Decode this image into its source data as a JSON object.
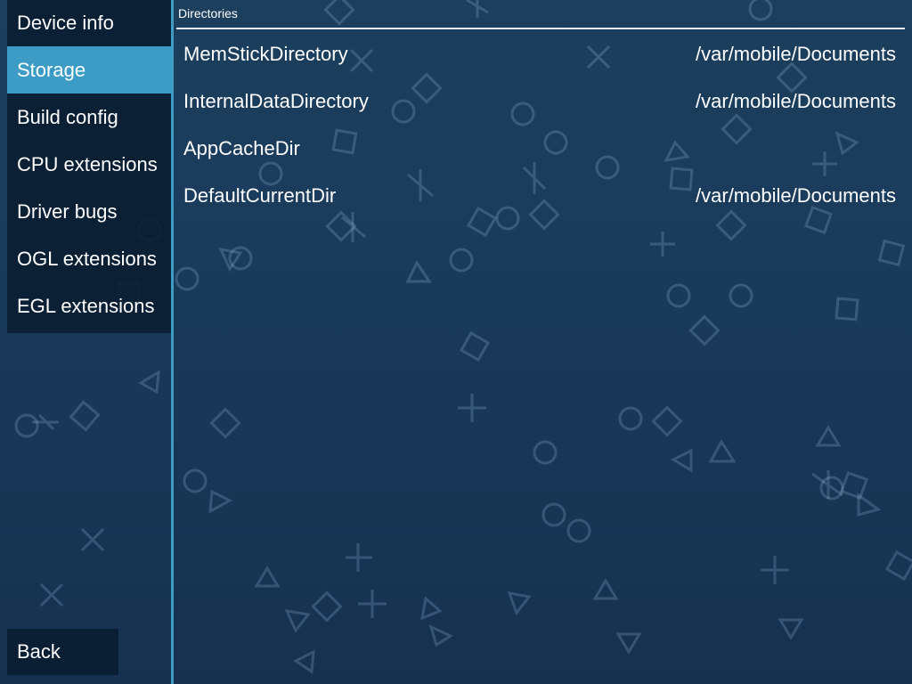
{
  "sidebar": {
    "items": [
      {
        "label": "Device info"
      },
      {
        "label": "Storage"
      },
      {
        "label": "Build config"
      },
      {
        "label": "CPU extensions"
      },
      {
        "label": "Driver bugs"
      },
      {
        "label": "OGL extensions"
      },
      {
        "label": "EGL extensions"
      }
    ],
    "selected": "Storage",
    "back_label": "Back"
  },
  "main": {
    "section_header": "Directories",
    "rows": [
      {
        "key": "MemStickDirectory",
        "value": "/var/mobile/Documents"
      },
      {
        "key": "InternalDataDirectory",
        "value": "/var/mobile/Documents"
      },
      {
        "key": "AppCacheDir",
        "value": ""
      },
      {
        "key": "DefaultCurrentDir",
        "value": "/var/mobile/Documents"
      }
    ]
  },
  "colors": {
    "accent": "#3c9cc6",
    "background_top": "#1c3f5e",
    "background_bottom": "#16314f",
    "panel": "#0a1c30"
  }
}
